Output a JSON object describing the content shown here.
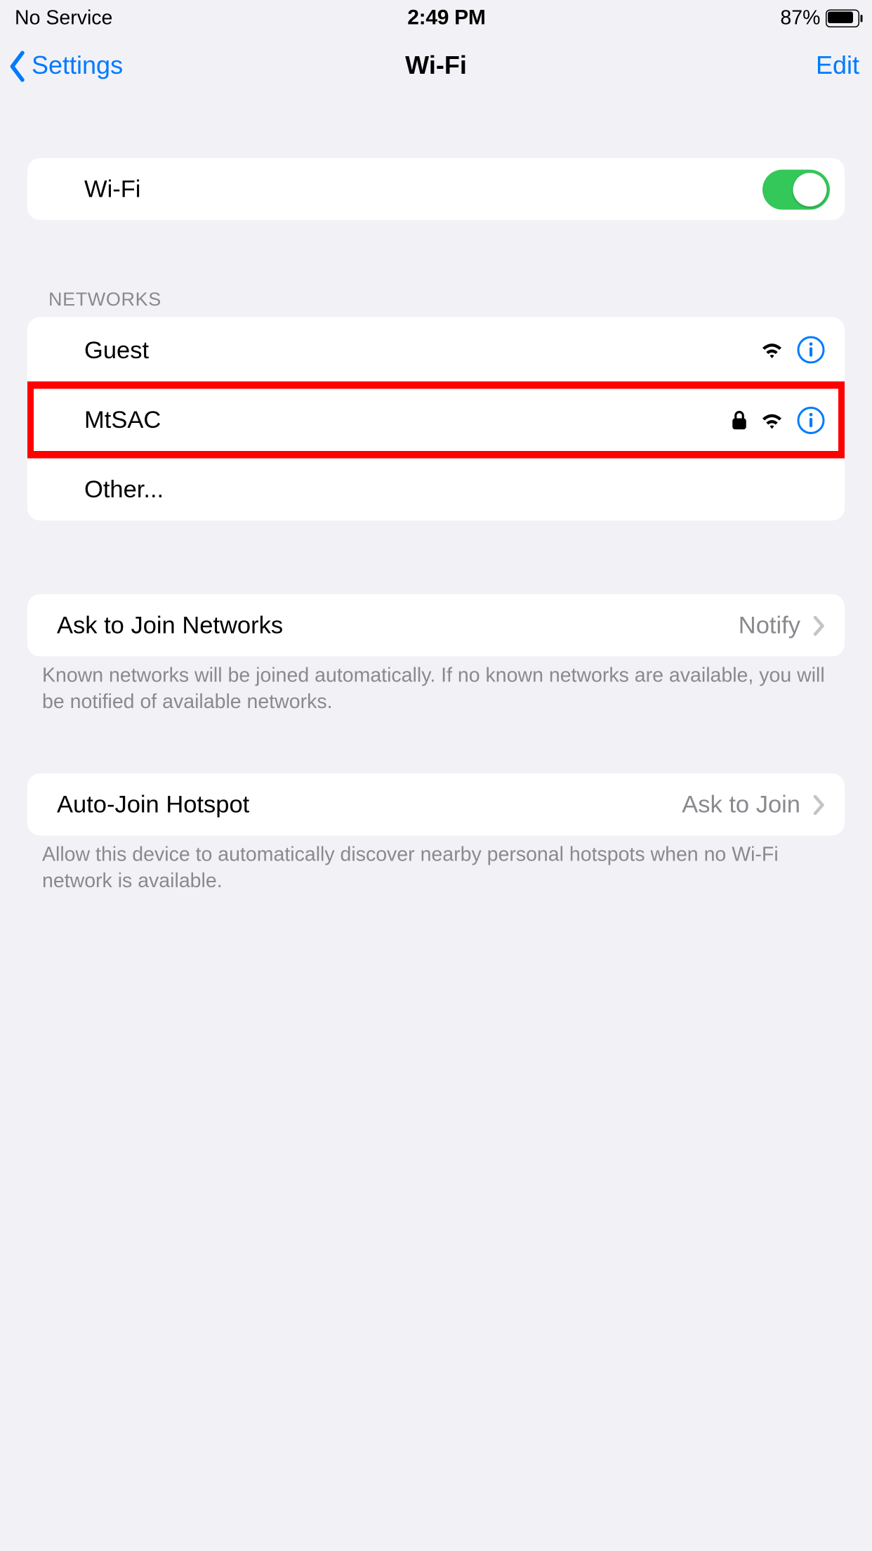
{
  "status": {
    "carrier": "No Service",
    "time": "2:49 PM",
    "battery_pct": "87%"
  },
  "nav": {
    "back_label": "Settings",
    "title": "Wi-Fi",
    "edit_label": "Edit"
  },
  "wifi": {
    "row_label": "Wi-Fi",
    "enabled": true
  },
  "networks": {
    "header": "Networks",
    "items": [
      {
        "name": "Guest",
        "locked": false,
        "highlighted": false
      },
      {
        "name": "MtSAC",
        "locked": true,
        "highlighted": true
      }
    ],
    "other_label": "Other..."
  },
  "ask_join": {
    "label": "Ask to Join Networks",
    "value": "Notify",
    "footer": "Known networks will be joined automatically. If no known networks are available, you will be notified of available networks."
  },
  "auto_hotspot": {
    "label": "Auto-Join Hotspot",
    "value": "Ask to Join",
    "footer": "Allow this device to automatically discover nearby personal hotspots when no Wi-Fi network is available."
  },
  "colors": {
    "tint": "#007aff",
    "toggle_on": "#34c759",
    "highlight": "#ff0000"
  }
}
